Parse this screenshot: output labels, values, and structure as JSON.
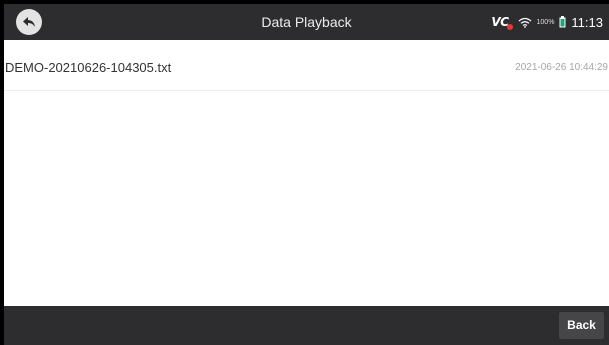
{
  "header": {
    "title": "Data Playback",
    "back_icon": "back-arrow-icon"
  },
  "status_bar": {
    "vci_label": "VC",
    "vci_icon": "vci-connection-icon",
    "wifi_icon": "wifi-icon",
    "battery_percent": "100%",
    "battery_icon": "battery-icon",
    "time": "11:13"
  },
  "files": [
    {
      "name": "DEMO-20210626-104305.txt",
      "date": "2021-06-26 10:44:29"
    }
  ],
  "footer": {
    "back_label": "Back"
  },
  "colors": {
    "header_bg": "#2d2d2f",
    "content_bg": "#ffffff",
    "vci_alert": "#e53935",
    "battery_fill": "#19a974"
  }
}
